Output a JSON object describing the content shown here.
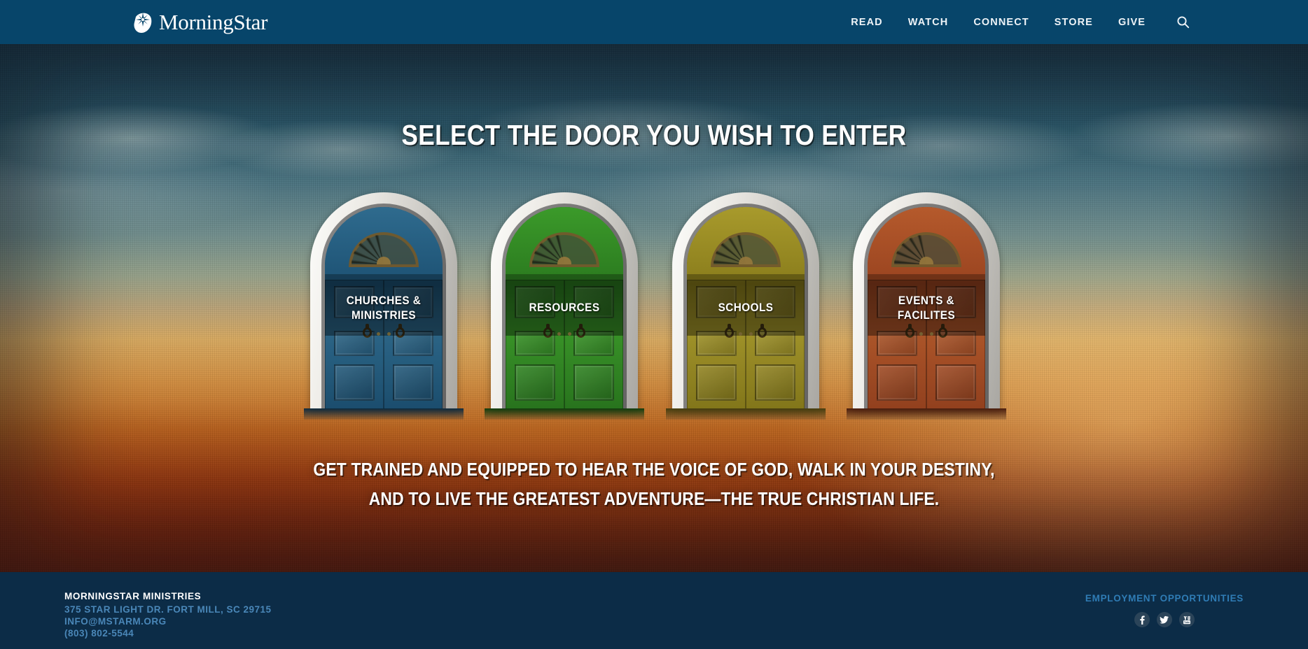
{
  "header": {
    "logo": {
      "text": "MorningStar",
      "icon": "star-comet-icon"
    },
    "nav": [
      {
        "label": "READ"
      },
      {
        "label": "WATCH"
      },
      {
        "label": "CONNECT"
      },
      {
        "label": "STORE"
      },
      {
        "label": "GIVE"
      }
    ],
    "search_icon": "search-icon",
    "background_color": "#07456a"
  },
  "hero": {
    "headline": "SELECT THE DOOR YOU WISH TO ENTER",
    "doors": [
      {
        "label": "CHURCHES & MINISTRIES",
        "color": "#1d5274",
        "wood_dark": "#11344b",
        "wood_light": "#2f6b8e",
        "accent": "#0f2b3e"
      },
      {
        "label": "RESOURCES",
        "color": "#2b7a1f",
        "wood_dark": "#174a12",
        "wood_light": "#3b9a2a",
        "accent": "#123d0e"
      },
      {
        "label": "SCHOOLS",
        "color": "#8a7d1c",
        "wood_dark": "#574d12",
        "wood_light": "#a89a2c",
        "accent": "#463e0f"
      },
      {
        "label": "EVENTS & FACILITES",
        "color": "#9a4420",
        "wood_dark": "#5e2712",
        "wood_light": "#b55a2c",
        "accent": "#4a1e0e"
      }
    ],
    "tagline_line1": "GET TRAINED AND EQUIPPED TO HEAR THE VOICE OF GOD, WALK IN YOUR DESTINY,",
    "tagline_line2": "AND TO LIVE THE GREATEST ADVENTURE—THE TRUE CHRISTIAN LIFE."
  },
  "footer": {
    "org_name": "MORNINGSTAR MINISTRIES",
    "address": "375 STAR LIGHT DR. FORT MILL, SC 29715",
    "email": "INFO@MSTARM.ORG",
    "phone": "(803) 802-5544",
    "employment_link": "EMPLOYMENT OPPORTUNITIES",
    "social": [
      {
        "name": "facebook-icon"
      },
      {
        "name": "twitter-icon"
      },
      {
        "name": "youtube-icon"
      }
    ],
    "background_color": "#0c2c47",
    "link_color": "#4a87b8"
  }
}
